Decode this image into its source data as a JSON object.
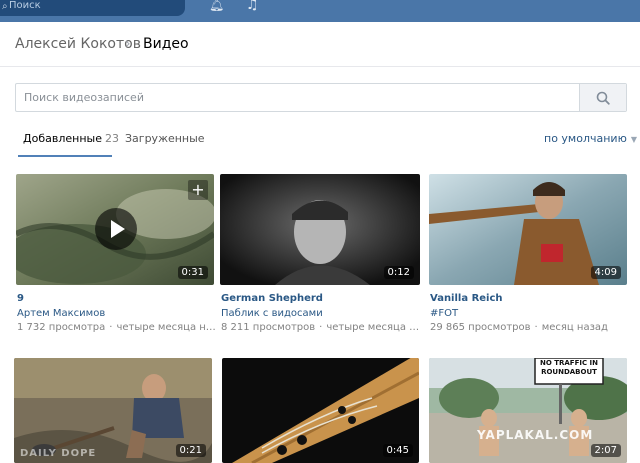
{
  "topbar": {
    "search_placeholder": "Поиск"
  },
  "breadcrumb": {
    "user": "Алексей Кокотов",
    "separator": "›",
    "page": "Видео"
  },
  "search": {
    "placeholder": "Поиск видеозаписей"
  },
  "tabs": {
    "added_label": "Добавленные",
    "added_count": "23",
    "uploaded_label": "Загруженные",
    "sort_label": "по умолчанию"
  },
  "videos": [
    {
      "title": "9",
      "author": "Артем Максимов",
      "views": "1 732 просмотра",
      "date": "четыре месяца назад",
      "duration": "0:31"
    },
    {
      "title": "German Shepherd",
      "author": "Паблик с видосами",
      "views": "8 211 просмотров",
      "date": "четыре месяца назад",
      "duration": "0:12"
    },
    {
      "title": "Vanilla Reich",
      "author": "#FOT",
      "views": "29 865 просмотров",
      "date": "месяц назад",
      "duration": "4:09"
    },
    {
      "duration": "0:21",
      "watermark": "DAILY DOPE"
    },
    {
      "duration": "0:45"
    },
    {
      "duration": "2:07",
      "sign": "NO TRAFFIC IN ROUNDABOUT",
      "watermark": "YAPLAKAL.COM"
    }
  ],
  "colors": {
    "topbar": "#4a76a8",
    "link": "#2a5885",
    "muted": "#828282",
    "page_bg": "#edeef0"
  }
}
